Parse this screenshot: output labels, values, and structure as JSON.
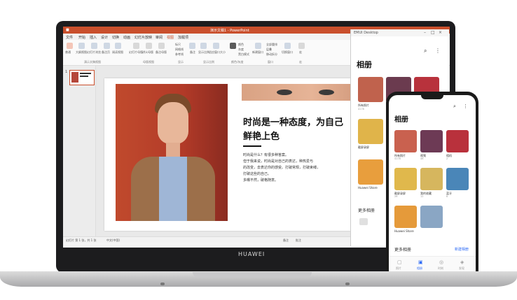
{
  "laptop": {
    "brand": "HUAWEI",
    "ppt": {
      "title": "演示文稿1 - PowerPoint",
      "menus": [
        "文件",
        "开始",
        "插入",
        "设计",
        "切换",
        "动画",
        "幻灯片放映",
        "审阅",
        "视图",
        "加载项"
      ],
      "active_menu": "视图",
      "ribbon_labels": [
        "普通",
        "大纲视图",
        "幻灯片浏览",
        "备注页",
        "阅读视图",
        "幻灯片母版",
        "讲义母版",
        "备注母版",
        "标尺",
        "网格线",
        "参考线",
        "备注",
        "显示比例",
        "适应窗口大小",
        "颜色",
        "灰度",
        "黑白模式",
        "新建窗口",
        "全部重排",
        "层叠",
        "移动拆分",
        "切换窗口",
        "宏"
      ],
      "group_labels": [
        "演示文稿视图",
        "母版视图",
        "显示",
        "显示比例",
        "颜色/灰度",
        "窗口",
        "宏"
      ],
      "slide_number": "1",
      "status_left": "幻灯片 第 1 张，共 1 张",
      "status_lang": "中文(中国)",
      "status_notes": "备注",
      "status_comments": "批注",
      "slide": {
        "heading_line1": "时尚是一种态度，为自己",
        "heading_line2": "鲜艳上色",
        "body": [
          "时尚是什么？有很多种答案。",
          "但于我来说，时尚是对自己的表达，种热爱与",
          "的改变，去表达你的感受。打破常规，打破束缚，",
          "打破这些的自己。",
          "多曝不然，破格随意。"
        ]
      }
    }
  },
  "emui_window": {
    "title": "EMUI Desktop",
    "album_title": "相册",
    "albums": [
      {
        "name": "所有照片",
        "count": "4178",
        "color": "#c0624d"
      },
      {
        "name": "",
        "count": "",
        "color": "#6b3b4f"
      },
      {
        "name": "",
        "count": "",
        "color": "#b8323c"
      },
      {
        "name": "截屏录屏",
        "count": "",
        "color": "#e0b44a"
      },
      {
        "name": "",
        "count": "",
        "color": "#d9c16b"
      },
      {
        "name": "",
        "count": "",
        "color": "#4b7bb5"
      },
      {
        "name": "Huawei Share",
        "count": "",
        "color": "#e89e3d"
      }
    ],
    "more_albums": "更多相册"
  },
  "phone": {
    "album_title": "相册",
    "albums": [
      {
        "name": "所有照片",
        "count": "4178",
        "color": "#c9614f"
      },
      {
        "name": "视频",
        "count": "46",
        "color": "#6d3a55"
      },
      {
        "name": "相机",
        "count": "2",
        "color": "#b9313c"
      },
      {
        "name": "截屏录屏",
        "count": "26",
        "color": "#e0b84c"
      },
      {
        "name": "我的收藏",
        "count": "12",
        "color": "#d6b65e"
      },
      {
        "name": "蓝牙",
        "count": "6",
        "color": "#4a86b8"
      },
      {
        "name": "Huawei Share",
        "count": "",
        "color": "#e59a3a"
      },
      {
        "name": "其它",
        "count": "",
        "color": "#8aa6c4"
      }
    ],
    "more_albums": "更多相册",
    "new_album": "新建相册",
    "tabs": [
      "照片",
      "相册",
      "时刻",
      "发现"
    ],
    "active_tab": "相册"
  },
  "colors": {
    "ppt_accent": "#c94f2c",
    "laptop_body": "#1c1c1e",
    "phone_accent": "#2f6cf6"
  }
}
